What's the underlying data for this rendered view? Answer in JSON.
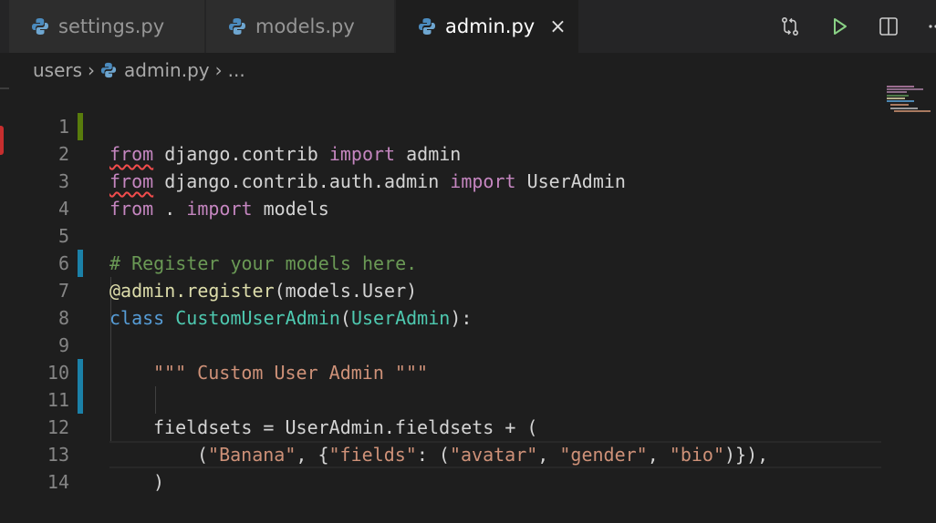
{
  "tabs": [
    {
      "label": "settings.py",
      "active": false
    },
    {
      "label": "models.py",
      "active": false
    },
    {
      "label": "admin.py",
      "active": true
    }
  ],
  "tab_close_glyph": "×",
  "actions": [
    "source-control-compare-icon",
    "run-icon",
    "split-editor-icon",
    "more-actions-icon"
  ],
  "breadcrumb": {
    "folder": "users",
    "file": "admin.py",
    "symbol": "..."
  },
  "editor": {
    "line_numbers": [
      "1",
      "2",
      "3",
      "4",
      "5",
      "6",
      "7",
      "8",
      "9",
      "10",
      "11",
      "12",
      "13",
      "14"
    ],
    "lines": {
      "l1": {
        "kw1": "from",
        "mod": " django.contrib ",
        "kw2": "import",
        "rest": " admin"
      },
      "l2": {
        "kw1": "from",
        "mod": " django.contrib.auth.admin ",
        "kw2": "import",
        "rest": " UserAdmin"
      },
      "l3": {
        "kw1": "from",
        "mod": " . ",
        "kw2": "import",
        "rest": " models"
      },
      "l5": {
        "comment": "# Register your models here."
      },
      "l6": {
        "at": "@",
        "obj": "admin",
        "dot": ".",
        "fn": "register",
        "rest": "(models.User)"
      },
      "l7": {
        "kw": "class",
        "sp": " ",
        "cls": "CustomUserAdmin",
        "open": "(",
        "base": "UserAdmin",
        "close": "):"
      },
      "l9": {
        "docstring": "\"\"\" Custom User Admin \"\"\""
      },
      "l11": {
        "text": "fieldsets = UserAdmin.fieldsets + ("
      },
      "l12": {
        "open": "(",
        "s1": "\"Banana\"",
        "c1": ", {",
        "s2": "\"fields\"",
        "c2": ": (",
        "s3": "\"avatar\"",
        "c3": ", ",
        "s4": "\"gender\"",
        "c4": ", ",
        "s5": "\"bio\"",
        "c5": ")}),"
      },
      "l13": {
        "text": ")"
      }
    }
  },
  "colors": {
    "gutter_modified": "#1b81a8",
    "gutter_added": "#587c0c",
    "keyword": "#c586c0",
    "string": "#ce9178",
    "comment": "#6a9955",
    "class": "#4ec9b0"
  }
}
